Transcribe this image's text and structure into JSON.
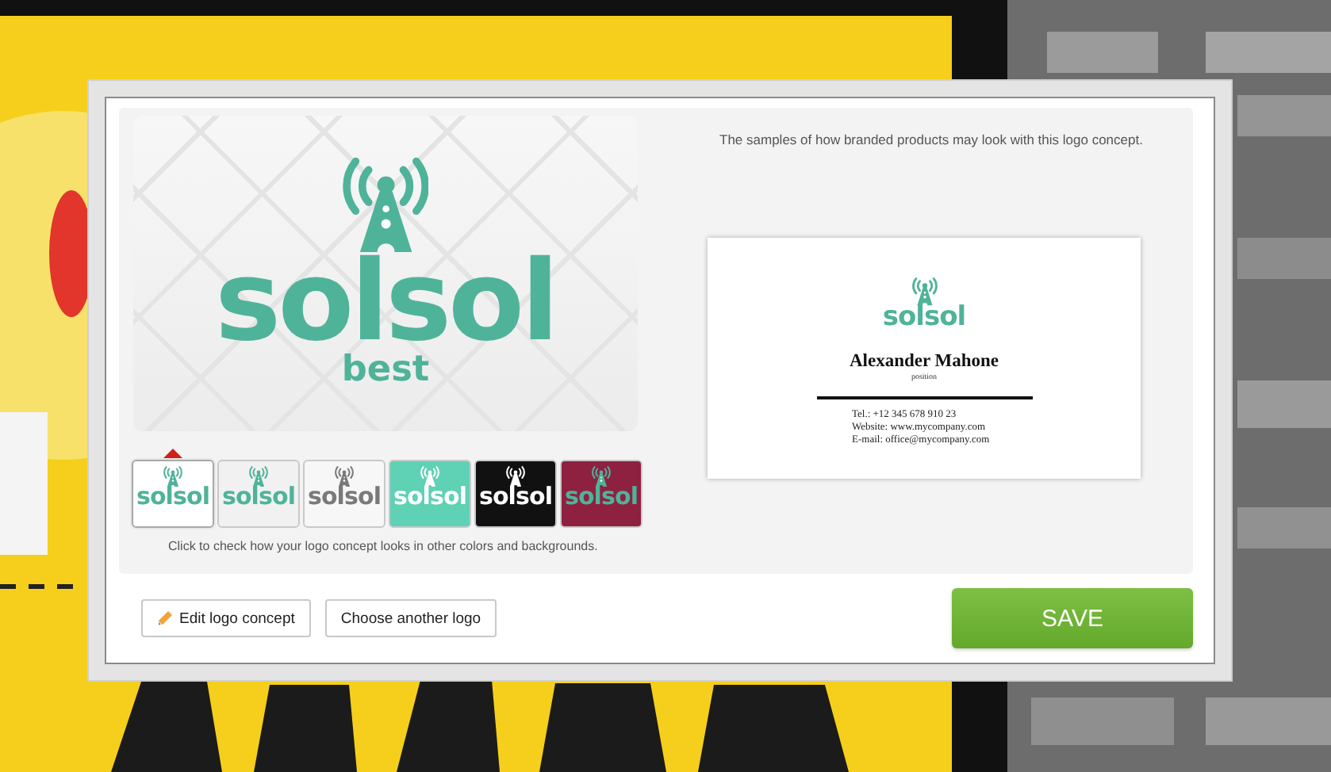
{
  "preview": {
    "logo_name": "solsol",
    "tagline": "best"
  },
  "swatches": [
    {
      "selected": true,
      "color": "#ffffff",
      "kind": "teal",
      "name": "solsol"
    },
    {
      "selected": false,
      "color": "#f1f1f1",
      "kind": "teal",
      "name": "solsol"
    },
    {
      "selected": false,
      "color": "#f7f7f7",
      "kind": "grey",
      "name": "solsol"
    },
    {
      "selected": false,
      "color": "#5fd1b4",
      "kind": "white",
      "name": "solsol"
    },
    {
      "selected": false,
      "color": "#111111",
      "kind": "white",
      "name": "solsol"
    },
    {
      "selected": false,
      "color": "#8e2140",
      "kind": "teal",
      "name": "solsol"
    }
  ],
  "swatch_hint": "Click to check how your logo concept looks in other colors and backgrounds.",
  "samples_caption": "The samples of how branded products may look with this logo concept.",
  "business_card": {
    "logo_name": "solsol",
    "person": "Alexander Mahone",
    "position": "position",
    "contacts": [
      "Tel.: +12 345 678 910 23",
      "Website: www.mycompany.com",
      "E-mail: office@mycompany.com"
    ]
  },
  "buttons": [
    {
      "kind": "edit",
      "label": "Edit logo concept"
    },
    {
      "kind": "plain",
      "label": "Choose another logo"
    }
  ],
  "save_button": "SAVE"
}
